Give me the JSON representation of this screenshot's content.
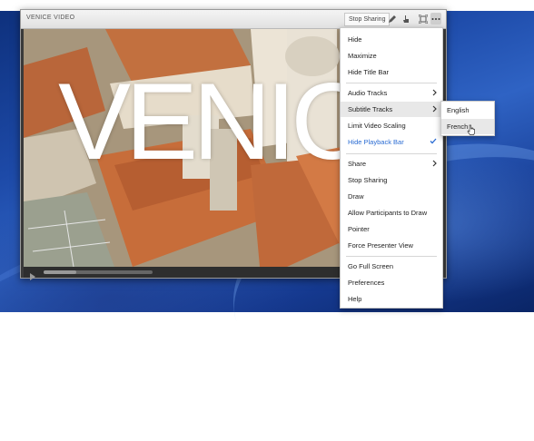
{
  "window": {
    "title": "VENICE VIDEO",
    "stop_sharing_label": "Stop Sharing"
  },
  "video": {
    "overlay_text": "VENIC",
    "progress": 0.3
  },
  "menu": {
    "items": [
      {
        "label": "Hide"
      },
      {
        "label": "Maximize"
      },
      {
        "label": "Hide Title Bar"
      },
      {
        "label": "Audio Tracks",
        "submenu": true
      },
      {
        "label": "Subtitle Tracks",
        "submenu": true,
        "highlighted": true
      },
      {
        "label": "Limit Video Scaling"
      },
      {
        "label": "Hide Playback Bar",
        "checked": true
      },
      {
        "label": "Share",
        "submenu": true
      },
      {
        "label": "Stop Sharing"
      },
      {
        "label": "Draw"
      },
      {
        "label": "Allow Participants to Draw"
      },
      {
        "label": "Pointer"
      },
      {
        "label": "Force Presenter View"
      },
      {
        "label": "Go Full Screen"
      },
      {
        "label": "Preferences"
      },
      {
        "label": "Help"
      }
    ]
  },
  "submenu": {
    "items": [
      {
        "label": "English"
      },
      {
        "label": "French",
        "highlighted": true
      }
    ]
  },
  "colors": {
    "accent": "#2b6cd3",
    "menu_bg": "#ffffff",
    "highlight": "#e8e8e8"
  }
}
